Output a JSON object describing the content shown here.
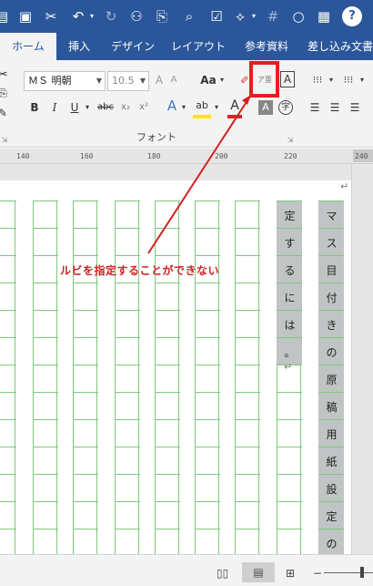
{
  "quick_access": {
    "icons": [
      "save-icon",
      "cut-icon",
      "undo-icon",
      "redo-icon",
      "structure-icon",
      "copy-icon",
      "print-preview-icon",
      "checkbox-icon",
      "shape-icon",
      "circle-icon",
      "help-icon"
    ]
  },
  "tabs": [
    "ホーム",
    "挿入",
    "デザイン",
    "レイアウト",
    "参考資料",
    "差し込み文書"
  ],
  "active_tab": "ホーム",
  "ribbon": {
    "font_name": "ＭＳ 明朝",
    "font_size": "10.5",
    "case_label": "Aa",
    "bold": "B",
    "italic": "I",
    "underline": "U",
    "strikethrough": "abc",
    "subscript": "x₂",
    "superscript": "x²",
    "phonetic_guide_label": "ア亜",
    "char_border_label": "A",
    "enclose_label": "字",
    "group_label": "フォント"
  },
  "ruler": {
    "ticks": [
      "140",
      "160",
      "180",
      "200",
      "220",
      "240"
    ]
  },
  "document": {
    "column1_chars": [
      "定",
      "す",
      "る",
      "に",
      "は",
      "。"
    ],
    "column2_chars": [
      "マ",
      "ス",
      "目",
      "付",
      "き",
      "の",
      "原",
      "稿",
      "用",
      "紙",
      "設",
      "定",
      "の"
    ],
    "paragraph_mark": "↵"
  },
  "annotation": {
    "text": "ルビを指定することができない",
    "color": "#d12222"
  },
  "colors": {
    "title_bar": "#2b579a",
    "grid": "#7ec87e",
    "selection": "#c0c4c4",
    "highlight_box": "#e41f1f"
  }
}
